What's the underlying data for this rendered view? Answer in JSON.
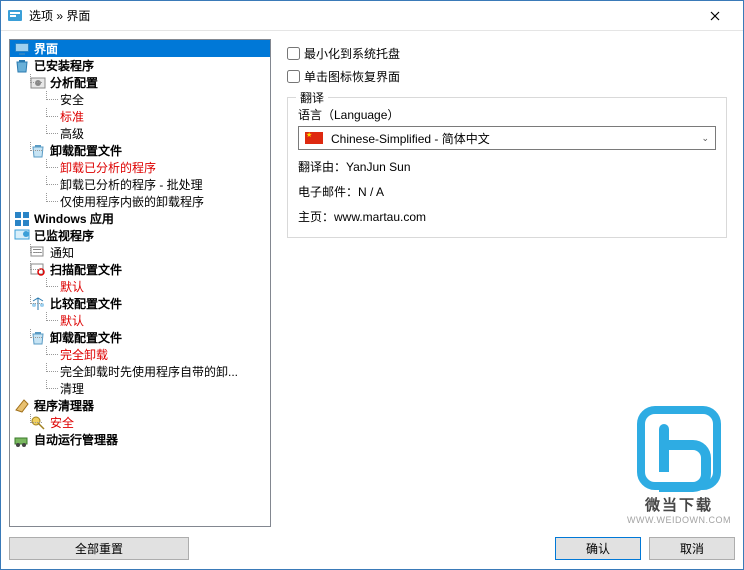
{
  "titlebar": {
    "text": "选项 » 界面"
  },
  "tree": {
    "interface": "界面",
    "installed_programs": "已安装程序",
    "analysis_config": "分析配置",
    "safe": "安全",
    "standard": "标准",
    "advanced": "高级",
    "uninstall_config_files": "卸载配置文件",
    "uninstall_analyzed": "卸载已分析的程序",
    "uninstall_analyzed_batch": "卸载已分析的程序 - 批处理",
    "only_builtin_uninstaller": "仅使用程序内嵌的卸载程序",
    "windows_apps": "Windows 应用",
    "monitored_programs": "已监视程序",
    "notifications": "通知",
    "scan_config_files": "扫描配置文件",
    "default1": "默认",
    "compare_config_files": "比较配置文件",
    "default2": "默认",
    "uninstall_config_files2": "卸载配置文件",
    "full_uninstall": "完全卸载",
    "full_uninstall_builtin_first": "完全卸载时先使用程序自带的卸...",
    "cleanup": "清理",
    "program_cleaner": "程序清理器",
    "cleaner_safe": "安全",
    "autorun_manager": "自动运行管理器"
  },
  "main": {
    "minimize_to_tray": "最小化到系统托盘",
    "click_icon_restore": "单击图标恢复界面",
    "translation_group": "翻译",
    "language_label": "语言（Language）",
    "language_value": "Chinese-Simplified - 简体中文",
    "translated_by_label": "翻译由：",
    "translated_by_value": "YanJun Sun",
    "email_label": "电子邮件：",
    "email_value": "N / A",
    "homepage_label": "主页：",
    "homepage_value": "www.martau.com"
  },
  "footer": {
    "reset_all": "全部重置",
    "ok": "确认",
    "cancel": "取消"
  },
  "watermark": {
    "text": "微当下载",
    "url": "WWW.WEIDOWN.COM"
  }
}
